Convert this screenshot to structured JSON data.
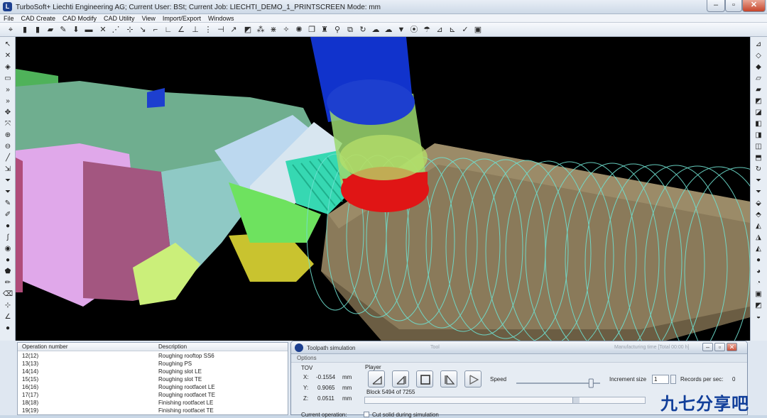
{
  "window": {
    "title": "TurboSoft+ Liechti Engineering AG; Current User: BSt; Current Job: LIECHTI_DEMO_1_PRINTSCREEN Mode: mm",
    "minimize": "–",
    "maximize": "▫",
    "close": "✕"
  },
  "menu": [
    "File",
    "CAD Create",
    "CAD Modify",
    "CAD Utility",
    "View",
    "Import/Export",
    "Windows"
  ],
  "operations": {
    "headers": {
      "number": "Operation number",
      "description": "Description"
    },
    "rows": [
      {
        "number": "12(12)",
        "description": "Roughing rooftop SS6"
      },
      {
        "number": "13(13)",
        "description": "Roughing PS"
      },
      {
        "number": "14(14)",
        "description": "Roughing slot LE"
      },
      {
        "number": "15(15)",
        "description": "Roughing slot TE"
      },
      {
        "number": "16(16)",
        "description": "Roughing rootfacet LE"
      },
      {
        "number": "17(17)",
        "description": "Roughing rootfacet TE"
      },
      {
        "number": "18(18)",
        "description": "Finishing rootfacet LE"
      },
      {
        "number": "19(19)",
        "description": "Finishing rootfacet TE"
      }
    ]
  },
  "toolpath": {
    "title": "Toolpath simulation",
    "ghost_left": "Tool",
    "ghost_right": "Manufacturing time [Total 00:00 h]",
    "options_label": "Options",
    "tov_label": "TOV",
    "x_label": "X:",
    "x_value": "-0.1554",
    "x_unit": "mm",
    "y_label": "Y:",
    "y_value": "0.9065",
    "y_unit": "mm",
    "z_label": "Z:",
    "z_value": "0.0511",
    "z_unit": "mm",
    "player_label": "Player",
    "speed_label": "Speed",
    "speed_level": 0.93,
    "increment_label": "Increment size",
    "increment_value": "1",
    "records_label": "Records per sec:",
    "records_value": "0",
    "block_text": "Block 5494 of 7255",
    "block_current": 5494,
    "block_total": 7255,
    "current_operation_label": "Current operation:",
    "cut_solid_label": "Cut solid during simulation"
  },
  "watermark": "九七分享吧",
  "colors": {
    "tool_shank": "#1133cc",
    "tool_body": "#9bd870",
    "tool_tip": "#e01515",
    "stock": "#8a7a5a",
    "toolpath": "#6fe0d0",
    "fixture": "#6fae8f",
    "accent": "#1c3f8f"
  }
}
